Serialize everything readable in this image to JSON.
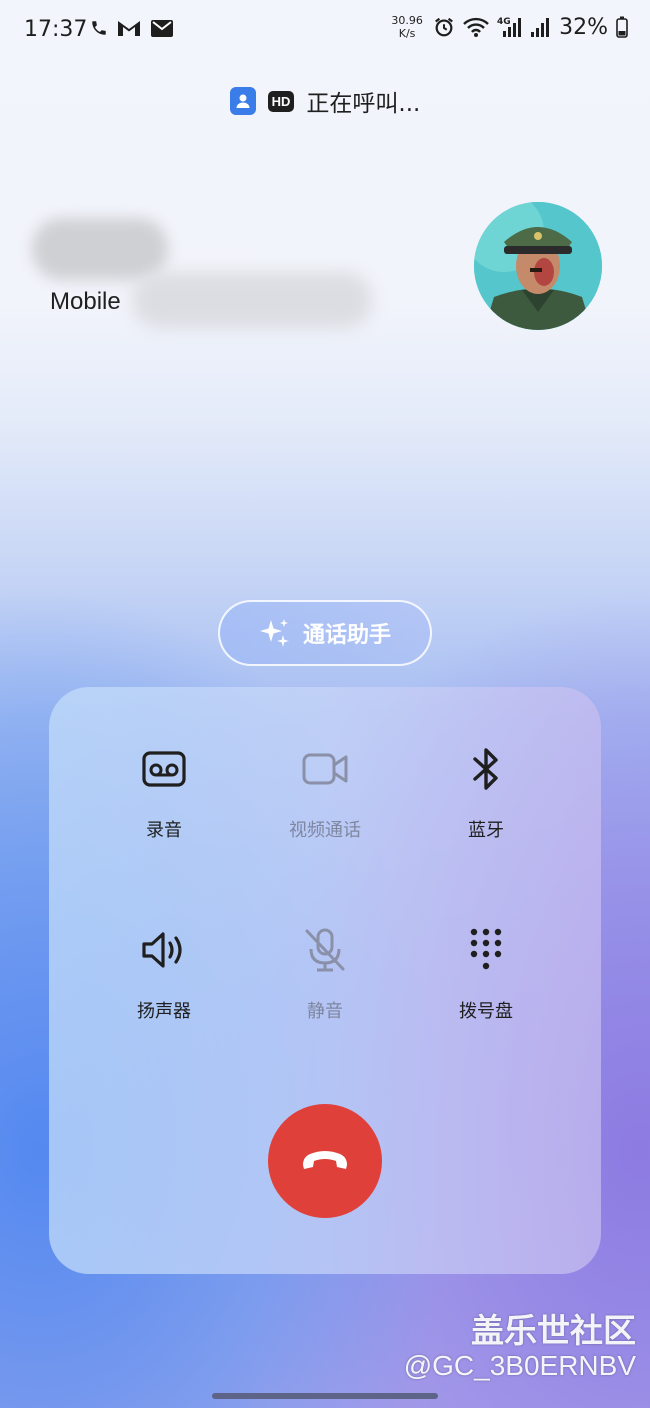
{
  "status_bar": {
    "time": "17:37",
    "left_icons": [
      "phone-icon",
      "gmail-icon",
      "mail-icon"
    ],
    "net_speed_value": "30.96",
    "net_speed_unit": "K/s",
    "right_icons": [
      "alarm-icon",
      "wifi-icon",
      "signal-4g-icon",
      "signal-icon",
      "battery-icon"
    ],
    "network_type": "4G",
    "battery": "32%"
  },
  "call": {
    "hd_badge": "HD",
    "status": "正在呼叫...",
    "number_type": "Mobile"
  },
  "assistant": {
    "label": "通话助手",
    "icon": "sparkle-icon"
  },
  "controls": [
    {
      "label": "录音",
      "icon": "voicemail-icon",
      "enabled": true
    },
    {
      "label": "视频通话",
      "icon": "video-icon",
      "enabled": false
    },
    {
      "label": "蓝牙",
      "icon": "bluetooth-icon",
      "enabled": true
    },
    {
      "label": "扬声器",
      "icon": "speaker-icon",
      "enabled": true
    },
    {
      "label": "静音",
      "icon": "mic-off-icon",
      "enabled": false
    },
    {
      "label": "拨号盘",
      "icon": "dialpad-icon",
      "enabled": true
    }
  ],
  "end_call": {
    "icon": "end-call-icon",
    "color": "#e0403a"
  },
  "watermark": {
    "line1": "盖乐世社区",
    "line2": "@GC_3B0ERNBV"
  }
}
